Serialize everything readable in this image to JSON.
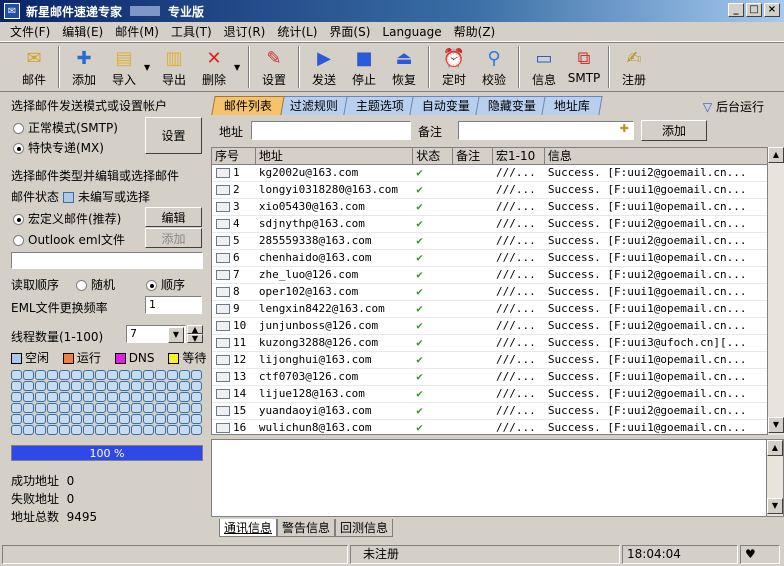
{
  "title": {
    "app": "新星邮件速递专家",
    "edition": "专业版"
  },
  "menu": [
    "文件(F)",
    "编辑(E)",
    "邮件(M)",
    "工具(T)",
    "退订(R)",
    "统计(L)",
    "界面(S)",
    "Language",
    "帮助(Z)"
  ],
  "toolbar": {
    "mail": "邮件",
    "add": "添加",
    "import": "导入",
    "export": "导出",
    "delete": "删除",
    "settings": "设置",
    "send": "发送",
    "stop": "停止",
    "resume": "恢复",
    "timer": "定时",
    "verify": "校验",
    "info": "信息",
    "smtp": "SMTP",
    "register": "注册"
  },
  "left": {
    "mode_title": "选择邮件发送模式或设置帐户",
    "mode_normal": "正常模式(SMTP)",
    "mode_fast": "特快专递(MX)",
    "settings_button": "设置",
    "type_title": "选择邮件类型并编辑或选择邮件",
    "status_label": "邮件状态",
    "status_value": "未编写或选择",
    "type_macro": "宏定义邮件(推荐)",
    "type_outlook": "Outlook eml文件",
    "edit_button": "编辑",
    "add_button": "添加",
    "read_order_label": "读取顺序",
    "order_random": "随机",
    "order_seq": "顺序",
    "eml_freq_label": "EML文件更换频率",
    "eml_freq_value": "1",
    "threads_label": "线程数量(1-100)",
    "threads_value": "7",
    "legend_idle": "空闲",
    "legend_running": "运行",
    "legend_dns": "DNS",
    "legend_wait": "等待",
    "progress_text": "100 %",
    "progress_fraction": 1.0,
    "success_label": "成功地址",
    "success_value": "0",
    "fail_label": "失败地址",
    "fail_value": "0",
    "total_label": "地址总数",
    "total_value": "9495"
  },
  "tabs": [
    "邮件列表",
    "过滤规则",
    "主题选项",
    "自动变量",
    "隐藏变量",
    "地址库"
  ],
  "background_run": "后台运行",
  "address_label": "地址",
  "remark_label": "备注",
  "add_button": "添加",
  "table": {
    "headers": [
      "序号",
      "地址",
      "状态",
      "备注",
      "宏1-10",
      "信息"
    ],
    "rows": [
      [
        "1",
        "kg2002u@163.com",
        "///...",
        "Success.  [F:uui2@goemail.cn..."
      ],
      [
        "2",
        "longyi0318280@163.com",
        "///...",
        "Success.  [F:uui1@goemail.cn..."
      ],
      [
        "3",
        "xio05430@163.com",
        "///...",
        "Success.  [F:uui1@opemail.cn..."
      ],
      [
        "4",
        "sdjnythp@163.com",
        "///...",
        "Success.  [F:uui2@goemail.cn..."
      ],
      [
        "5",
        "285559338@163.com",
        "///...",
        "Success.  [F:uui2@goemail.cn..."
      ],
      [
        "6",
        "chenhaido@163.com",
        "///...",
        "Success.  [F:uui1@opemail.cn..."
      ],
      [
        "7",
        "zhe_luo@126.com",
        "///...",
        "Success.  [F:uui2@goemail.cn..."
      ],
      [
        "8",
        "oper102@163.com",
        "///...",
        "Success.  [F:uui1@goemail.cn..."
      ],
      [
        "9",
        "lengxin8422@163.com",
        "///...",
        "Success.  [F:uui1@opemail.cn..."
      ],
      [
        "10",
        "junjunboss@126.com",
        "///...",
        "Success.  [F:uui2@goemail.cn..."
      ],
      [
        "11",
        "kuzong3288@126.com",
        "///...",
        "Success.  [F:uui3@ufoch.cn][..."
      ],
      [
        "12",
        "lijonghui@163.com",
        "///...",
        "Success.  [F:uui1@opemail.cn..."
      ],
      [
        "13",
        "ctf0703@126.com",
        "///...",
        "Success.  [F:uui1@opemail.cn..."
      ],
      [
        "14",
        "lijue128@163.com",
        "///...",
        "Success.  [F:uui2@goemail.cn..."
      ],
      [
        "15",
        "yuandaoyi@163.com",
        "///...",
        "Success.  [F:uui2@goemail.cn..."
      ],
      [
        "16",
        "wulichun8@163.com",
        "///...",
        "Success.  [F:uui1@goemail.cn..."
      ]
    ]
  },
  "bottom_tabs": [
    "通讯信息",
    "警告信息",
    "回测信息"
  ],
  "status": {
    "register": "未注册",
    "time": "18:04:04"
  }
}
